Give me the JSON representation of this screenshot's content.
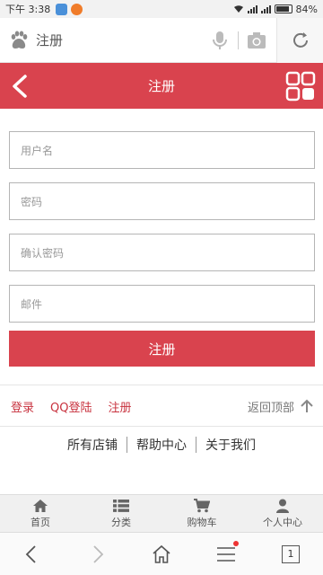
{
  "status_bar": {
    "time": "下午 3:38",
    "battery": "84%"
  },
  "browser": {
    "query": "注册"
  },
  "header": {
    "title": "注册"
  },
  "form": {
    "username_placeholder": "用户名",
    "password_placeholder": "密码",
    "confirm_placeholder": "确认密码",
    "email_placeholder": "邮件",
    "submit_label": "注册"
  },
  "links": {
    "login": "登录",
    "qq_login": "QQ登陆",
    "register": "注册",
    "back_to_top": "返回顶部"
  },
  "footer_links": [
    "所有店铺",
    "帮助中心",
    "关于我们"
  ],
  "tabbar": [
    {
      "label": "首页",
      "icon": "home-icon"
    },
    {
      "label": "分类",
      "icon": "list-icon"
    },
    {
      "label": "购物车",
      "icon": "cart-icon"
    },
    {
      "label": "个人中心",
      "icon": "person-icon"
    }
  ],
  "browser_nav": {
    "tab_count": "1"
  },
  "colors": {
    "brand_red": "#d9434e",
    "link_red": "#c8323e"
  }
}
